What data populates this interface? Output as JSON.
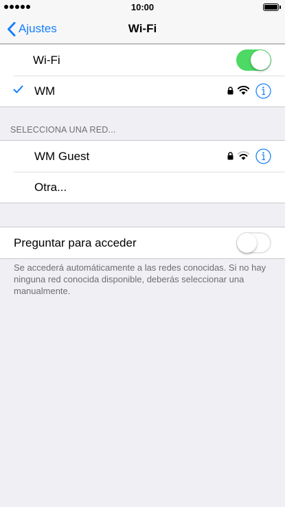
{
  "status_bar": {
    "time": "10:00",
    "signal_dots": 5
  },
  "nav": {
    "back_label": "Ajustes",
    "title": "Wi-Fi"
  },
  "wifi": {
    "label": "Wi-Fi",
    "enabled": true,
    "connected_network": {
      "name": "WM",
      "secured": true,
      "selected": true
    }
  },
  "networks_section": {
    "header": "SELECCIONA UNA RED...",
    "items": [
      {
        "name": "WM Guest",
        "secured": true
      },
      {
        "name": "Otra..."
      }
    ]
  },
  "ask_to_join": {
    "label": "Preguntar para acceder",
    "enabled": false,
    "footer": "Se accederá automáticamente a las redes conocidas. Si no hay ninguna red conocida disponible, deberás seleccionar una manualmente."
  },
  "colors": {
    "accent": "#157efb",
    "toggle_on": "#4cd964",
    "background": "#efeff4"
  },
  "icons": {
    "back": "chevron-left-icon",
    "check": "checkmark-icon",
    "lock": "lock-icon",
    "wifi": "wifi-icon",
    "info": "info-icon"
  }
}
